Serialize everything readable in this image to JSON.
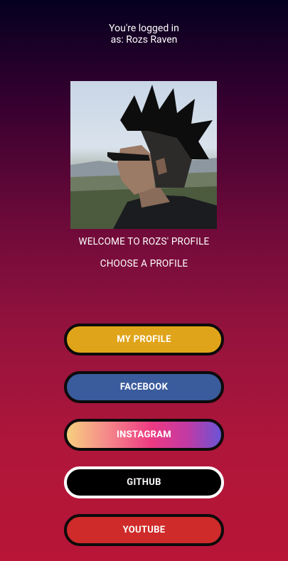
{
  "login": {
    "line1": "You're logged in",
    "line2": "as: Rozs Raven"
  },
  "profile": {
    "welcome": "WELCOME TO ROZS' PROFILE",
    "choose": "CHOOSE A PROFILE"
  },
  "buttons": {
    "my_profile": "MY PROFILE",
    "facebook": "FACEBOOK",
    "instagram": "INSTAGRAM",
    "github": "GITHUB",
    "youtube": "YOUTUBE"
  },
  "colors": {
    "my_profile": "#e0a41a",
    "facebook": "#3a5b9c",
    "github": "#000000",
    "youtube": "#cf2b2b"
  }
}
